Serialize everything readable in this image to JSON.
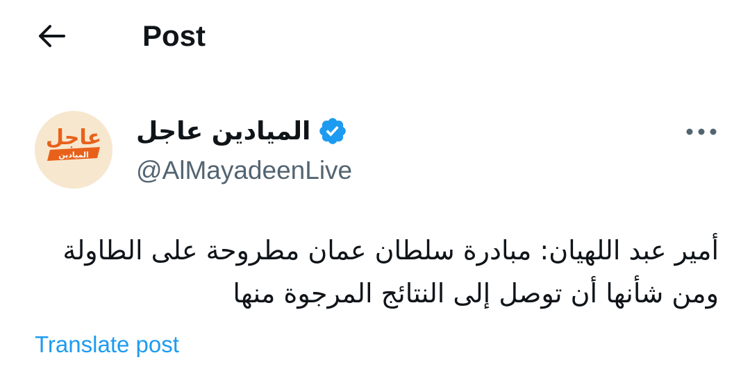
{
  "header": {
    "title": "Post",
    "back_icon": "arrow-left-icon"
  },
  "author": {
    "display_name": "الميادين عاجل",
    "handle": "@AlMayadeenLive",
    "verified": true,
    "verified_icon": "verified-badge-icon",
    "avatar": {
      "logo_text": "عاجل",
      "logo_subtext": "الميادين",
      "background": "#f7e7cf",
      "accent": "#e8611a"
    }
  },
  "more_icon": "more-horizontal-icon",
  "post": {
    "lines": [
      "أمير عبد اللهيان: مبادرة سلطان عمان مطروحة على الطاولة",
      "ومن شأنها أن توصل إلى النتائج المرجوة منها"
    ],
    "translate_label": "Translate post"
  },
  "colors": {
    "text": "#0f1419",
    "secondary": "#536471",
    "link": "#1d9bf0"
  }
}
